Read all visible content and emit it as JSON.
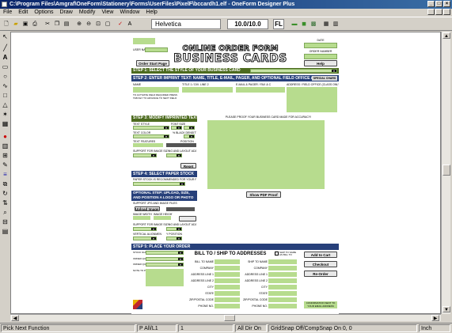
{
  "window": {
    "title": "C:\\Program Files\\Amgraf\\OneForm\\Stationery\\Forms\\UserFiles\\PixelF\\bccardh1.elf - OneForm Designer Plus",
    "minimize": "_",
    "maximize": "□",
    "close": "×"
  },
  "menubar": {
    "items": [
      "File",
      "Edit",
      "Options",
      "Draw",
      "Modify",
      "View",
      "Window",
      "Help"
    ]
  },
  "toolbar": {
    "font": "Helvetica",
    "size": "10.0/10.0",
    "fill_button": "FL"
  },
  "form": {
    "title_line1": "ONLINE ORDER FORM",
    "title_line2": "BUSINESS CARDS",
    "date_label": "DATE",
    "order_number_label": "ORDER NUMBER",
    "user_name_label": "USER NAME",
    "order_start_page": "Order Start Page",
    "help": "Help",
    "step1": "STEP 1: SELECT THE STYLE OF YOUR BUSINESS CARD",
    "step2": "STEP 2: ENTER IMPRINT TEXT: NAME, TITLE, E-MAIL, PAGER, AND OPTIONAL FIELD OFFICE ADDRESS",
    "special_chars": "SPECIAL CHARS",
    "col_name": "NAME",
    "col_title": "TITLE 1 / DIV. LINE 2",
    "col_email": "E-MAIL & PAGER / FAX & C",
    "col_address": "ADDRESS / FIELD OFFICE (CLASS ONLY)",
    "name_note": "TO ACTIVATE FIELD REQUIRED PRESS TAB KEY TO ADVANCE TO NEXT FIELD",
    "step3": "STEP 3: MODIFY IMPRINTED TEXT",
    "text_style": "TEXT STYLE",
    "font_size": "FONT SIZE",
    "text_color": "TEXT COLOR",
    "text_density": "% BLACK DENSITY",
    "text_features": "TEXT FEATURES",
    "position": "POSITION",
    "support_note": "SUPPORT FOR IMAGE SIZING AND LAYOUT ADJUSTMENT",
    "reset": "Reset",
    "proof_text": "PLEASE PROOF YOUR BUSINESS CARD MADE FOR ACCURACY!",
    "step4": "STEP 4: SELECT PAPER STOCK",
    "paper_note": "PAPER STOCK IS RECOMMENDED FOR YOUR PRINT",
    "show_pdf": "Show PDF Proof",
    "step_opt": "OPTIONAL STEP: UPLOAD, SIZE, AND POSITION A LOGO OR PHOTO",
    "upload_note": "SUPPORT JPG AND IMAGE FILES",
    "upload_image": "Upload Image File",
    "image_width": "IMAGE WIDTH",
    "image_height": "IMAGE HEIGHT",
    "vertical_alignment": "VERTICAL ALIGNMENT",
    "y_position": "Y POSITION",
    "step5": "STEP 5: PLACE YOUR ORDER",
    "bill_ship": "BILL TO / SHIP TO ADDRESSES",
    "ship_same": "SHIP TO SAME AS BILL TO",
    "add_cart": "Add to Cart",
    "checkout": "Checkout",
    "reorder": "Re-Order",
    "confirmation": "CONFIRMATION SENT TO YOUR EMAIL ADDRESS",
    "bill_fields": [
      "BILL TO NAME",
      "COMPANY",
      "ADDRESS LINE 1",
      "ADDRESS LINE 2",
      "CITY",
      "STATE",
      "ZIP/POSTAL CODE",
      "PHONE NO."
    ],
    "ship_fields": [
      "SHIP TO NAME",
      "COMPANY",
      "ADDRESS LINE 1",
      "ADDRESS LINE 2",
      "CITY",
      "STATE",
      "ZIP/POSTAL CODE",
      "PHONE NO."
    ],
    "order_labels": [
      "STOCK NUMBER",
      "ORDER QUANTITY",
      "ORDER QUANTITY",
      "NOTE TO PRINTER"
    ]
  },
  "status": {
    "function": "Pick Next Function",
    "page": "P All/L1",
    "layer": "1",
    "dir": "All Dir On",
    "grid": "GridSnap Off/CompSnap On  0, 0",
    "units": "Inch"
  }
}
